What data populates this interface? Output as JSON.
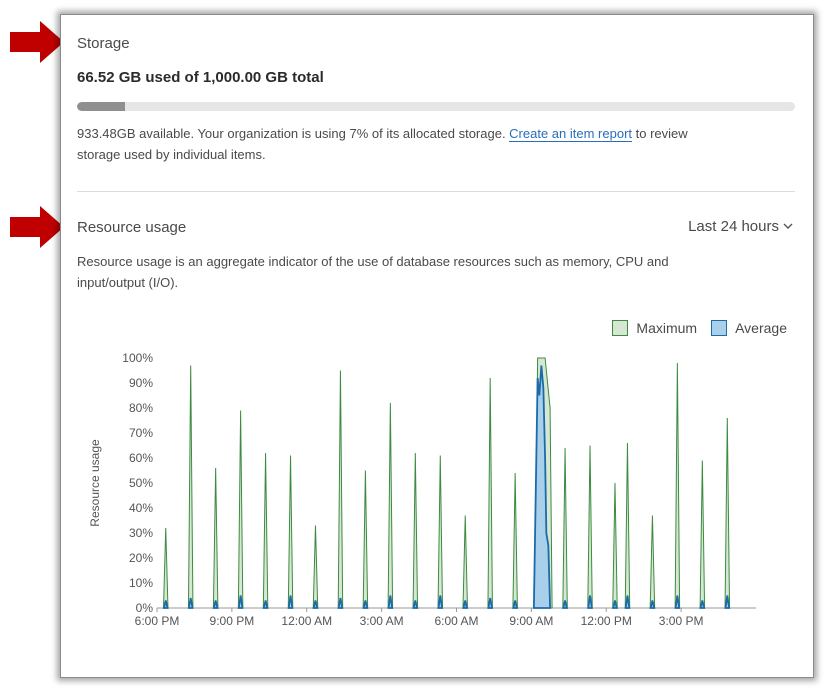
{
  "storage": {
    "title": "Storage",
    "used_summary": "66.52 GB used of 1,000.00 GB total",
    "used_fraction": 0.0665,
    "availability_text": "933.48GB available. Your organization is using 7% of its allocated storage. ",
    "report_link": "Create an item report",
    "availability_tail": " to review",
    "availability_line2": "storage used by individual items."
  },
  "resource": {
    "title": "Resource usage",
    "range_label": "Last 24 hours",
    "range_icon": "chevron-down-icon",
    "description_line1": "Resource usage is an aggregate indicator of the use of database resources such as memory, CPU and",
    "description_line2": "input/output (I/O)."
  },
  "annotations": {
    "arrow_icon": "red-arrow-icon",
    "arrow_color": "#c00000"
  },
  "colors": {
    "max_fill": "#d6e8d3",
    "max_stroke": "#3d8b40",
    "avg_fill": "#a9d0ea",
    "avg_stroke": "#1c6aa8",
    "storage_bar": "#8f8f8f"
  },
  "chart_data": {
    "type": "area",
    "ylabel": "Resource usage",
    "yticks": [
      "100%",
      "90%",
      "80%",
      "70%",
      "60%",
      "50%",
      "40%",
      "30%",
      "20%",
      "10%",
      "0%"
    ],
    "ylim": [
      0,
      100
    ],
    "xticks": [
      "6:00 PM",
      "9:00 PM",
      "12:00 AM",
      "3:00 AM",
      "6:00 AM",
      "9:00 AM",
      "12:00 PM",
      "3:00 PM"
    ],
    "xlim_hours": [
      0,
      24
    ],
    "legend": [
      "Maximum",
      "Average"
    ],
    "legend_position": "top-right",
    "grid": false,
    "series": [
      {
        "name": "Maximum",
        "spikes": [
          {
            "t": 0.35,
            "v": 32
          },
          {
            "t": 1.35,
            "v": 97
          },
          {
            "t": 2.35,
            "v": 56
          },
          {
            "t": 3.35,
            "v": 79
          },
          {
            "t": 4.35,
            "v": 62
          },
          {
            "t": 5.35,
            "v": 61
          },
          {
            "t": 6.35,
            "v": 33
          },
          {
            "t": 7.35,
            "v": 95
          },
          {
            "t": 8.35,
            "v": 55
          },
          {
            "t": 9.35,
            "v": 82
          },
          {
            "t": 10.35,
            "v": 62
          },
          {
            "t": 11.35,
            "v": 61
          },
          {
            "t": 12.35,
            "v": 37
          },
          {
            "t": 13.35,
            "v": 92
          },
          {
            "t": 14.35,
            "v": 54
          },
          {
            "t": 16.35,
            "v": 64
          },
          {
            "t": 17.35,
            "v": 65
          },
          {
            "t": 18.35,
            "v": 50
          },
          {
            "t": 18.85,
            "v": 66
          },
          {
            "t": 19.85,
            "v": 37
          },
          {
            "t": 20.85,
            "v": 98
          },
          {
            "t": 21.85,
            "v": 59
          },
          {
            "t": 22.85,
            "v": 76
          }
        ],
        "plateau": {
          "start": 15.25,
          "end": 15.55,
          "v": 100
        }
      },
      {
        "name": "Average",
        "spikes": [
          {
            "t": 0.35,
            "v": 3
          },
          {
            "t": 1.35,
            "v": 4
          },
          {
            "t": 2.35,
            "v": 3
          },
          {
            "t": 3.35,
            "v": 5
          },
          {
            "t": 4.35,
            "v": 3
          },
          {
            "t": 5.35,
            "v": 5
          },
          {
            "t": 6.35,
            "v": 3
          },
          {
            "t": 7.35,
            "v": 4
          },
          {
            "t": 8.35,
            "v": 3
          },
          {
            "t": 9.35,
            "v": 5
          },
          {
            "t": 10.35,
            "v": 3
          },
          {
            "t": 11.35,
            "v": 5
          },
          {
            "t": 12.35,
            "v": 3
          },
          {
            "t": 13.35,
            "v": 4
          },
          {
            "t": 14.35,
            "v": 3
          },
          {
            "t": 16.35,
            "v": 3
          },
          {
            "t": 17.35,
            "v": 5
          },
          {
            "t": 18.35,
            "v": 3
          },
          {
            "t": 18.85,
            "v": 5
          },
          {
            "t": 19.85,
            "v": 3
          },
          {
            "t": 20.85,
            "v": 5
          },
          {
            "t": 21.85,
            "v": 3
          },
          {
            "t": 22.85,
            "v": 5
          }
        ],
        "plateau_points": [
          {
            "t": 15.1,
            "v": 0
          },
          {
            "t": 15.25,
            "v": 92
          },
          {
            "t": 15.32,
            "v": 85
          },
          {
            "t": 15.4,
            "v": 97
          },
          {
            "t": 15.48,
            "v": 88
          },
          {
            "t": 15.55,
            "v": 60
          },
          {
            "t": 15.6,
            "v": 30
          },
          {
            "t": 15.68,
            "v": 25
          },
          {
            "t": 15.75,
            "v": 0
          }
        ]
      }
    ]
  }
}
